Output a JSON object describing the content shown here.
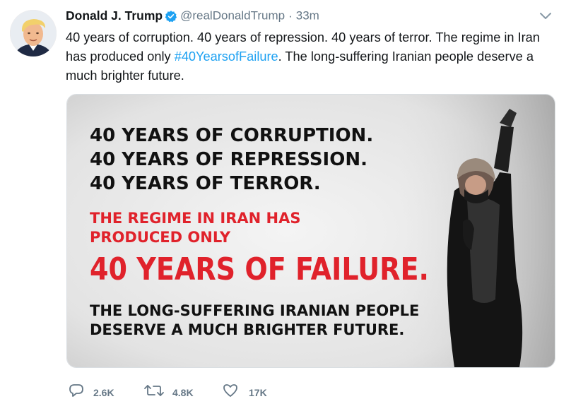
{
  "tweet": {
    "author_name": "Donald J. Trump",
    "handle": "@realDonaldTrump",
    "separator": "·",
    "time": "33m",
    "text_before": "40 years of corruption. 40 years of repression. 40 years of terror. The regime in Iran has produced only ",
    "hashtag": "#40YearsofFailure",
    "text_after": ". The long-suffering Iranian people deserve a much brighter future."
  },
  "media": {
    "line1": "40 YEARS OF CORRUPTION.",
    "line2": "40 YEARS OF REPRESSION.",
    "line3": "40 YEARS OF TERROR.",
    "red1": "THE REGIME IN IRAN HAS",
    "red2": "PRODUCED ONLY",
    "big": "40 YEARS OF FAILURE.",
    "bottom1": "THE LONG-SUFFERING IRANIAN PEOPLE",
    "bottom2": "DESERVE A MUCH BRIGHTER FUTURE."
  },
  "actions": {
    "replies": "2.6K",
    "retweets": "4.8K",
    "likes": "17K"
  },
  "colors": {
    "accent": "#1da1f2",
    "muted": "#657786",
    "headline_red": "#e0222b",
    "headline_black": "#111111"
  },
  "icons": [
    "verified-badge-icon",
    "chevron-down-icon",
    "reply-icon",
    "retweet-icon",
    "like-icon"
  ]
}
